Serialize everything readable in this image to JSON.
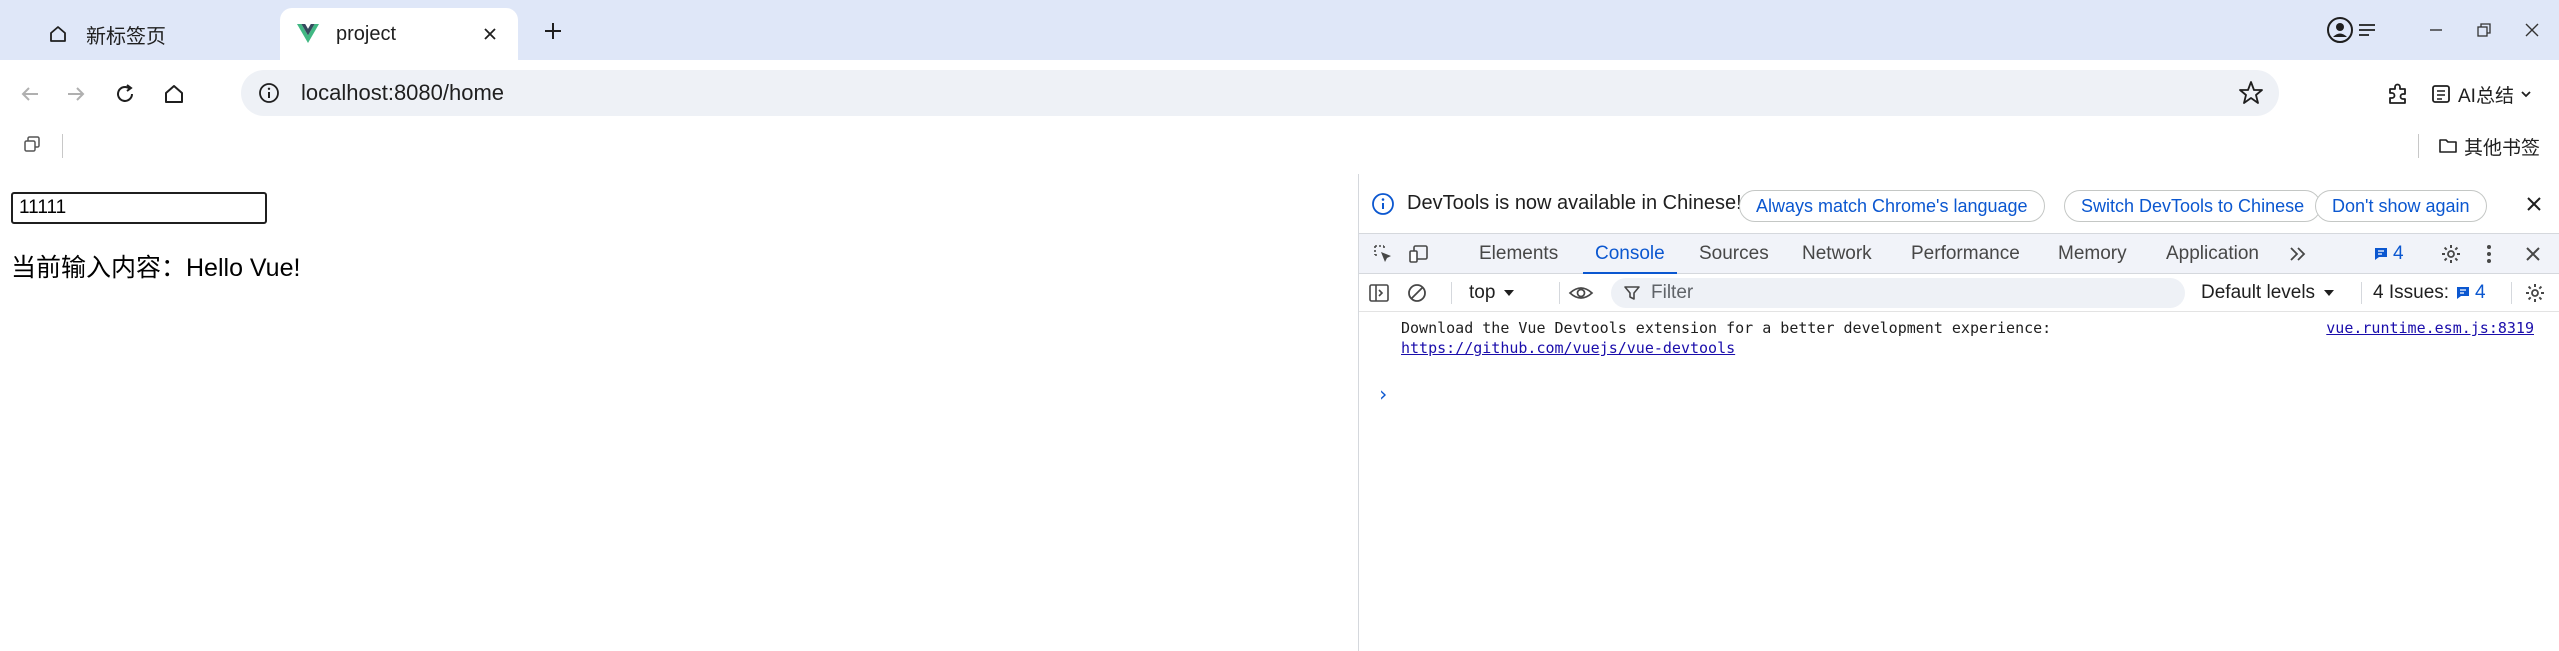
{
  "browser": {
    "tabs": [
      {
        "title": "新标签页",
        "icon": "new-tab-page-icon",
        "active": false
      },
      {
        "title": "project",
        "icon": "vue-logo-icon",
        "active": true
      }
    ],
    "address_bar": {
      "url": "localhost:8080/home"
    },
    "toolbar": {
      "ai_label": "AI总结"
    },
    "bookmarks_bar": {
      "other_bookmarks": "其他书签"
    }
  },
  "page": {
    "input": {
      "value": "11111"
    },
    "output_text": "当前输入内容：Hello Vue!"
  },
  "devtools": {
    "banner": {
      "text": "DevTools is now available in Chinese!",
      "buttons": [
        "Always match Chrome's language",
        "Switch DevTools to Chinese",
        "Don't show again"
      ]
    },
    "tabs": [
      "Elements",
      "Console",
      "Sources",
      "Network",
      "Performance",
      "Memory",
      "Application"
    ],
    "active_tab": "Console",
    "message_count": "4",
    "console_toolbar": {
      "context": "top",
      "filter_placeholder": "Filter",
      "levels": "Default levels",
      "issues_label": "4 Issues:",
      "issues_count": "4"
    },
    "messages": [
      {
        "text": "Download the Vue Devtools extension for a better development experience:",
        "link": "https://github.com/vuejs/vue-devtools",
        "source": "vue.runtime.esm.js:8319"
      }
    ]
  },
  "colors": {
    "accent": "#0b57d0",
    "vue_green": "#41b883",
    "vue_dark": "#35495e",
    "tabstrip_bg": "#dfe7f8"
  }
}
